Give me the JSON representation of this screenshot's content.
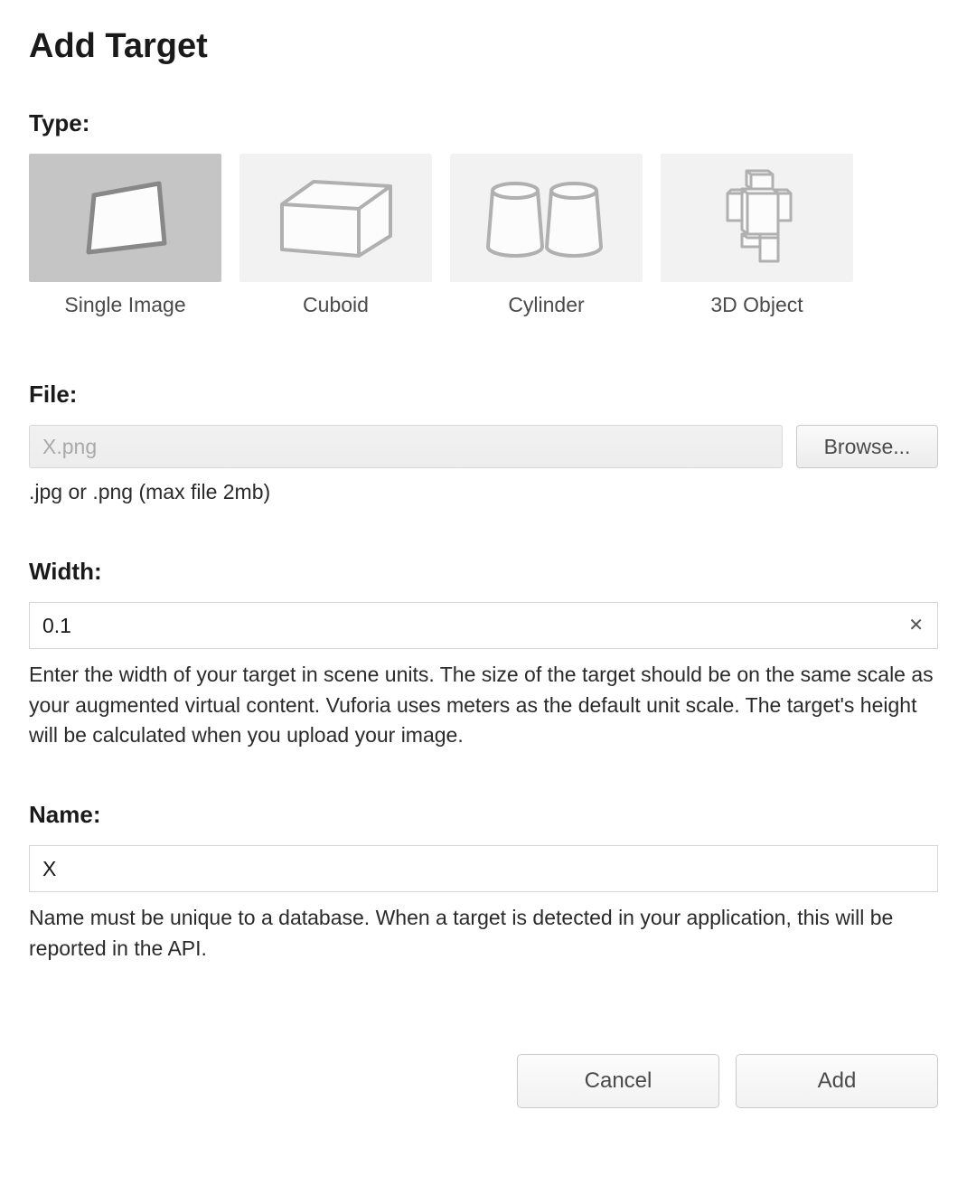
{
  "title": "Add Target",
  "type": {
    "label": "Type:",
    "selectedIndex": 0,
    "options": [
      {
        "label": "Single Image",
        "iconName": "image-icon"
      },
      {
        "label": "Cuboid",
        "iconName": "cuboid-icon"
      },
      {
        "label": "Cylinder",
        "iconName": "cylinder-icon"
      },
      {
        "label": "3D Object",
        "iconName": "object3d-icon"
      }
    ]
  },
  "file": {
    "label": "File:",
    "value": "X.png",
    "browse": "Browse...",
    "help": ".jpg or .png (max file 2mb)"
  },
  "width": {
    "label": "Width:",
    "value": "0.1",
    "help": "Enter the width of your target in scene units. The size of the target should be on the same scale as your augmented virtual content. Vuforia uses meters as the default unit scale. The target's height will be calculated when you upload your image."
  },
  "name": {
    "label": "Name:",
    "value": "X",
    "help": "Name must be unique to a database. When a target is detected in your application, this will be reported in the API."
  },
  "footer": {
    "cancel": "Cancel",
    "add": "Add"
  }
}
